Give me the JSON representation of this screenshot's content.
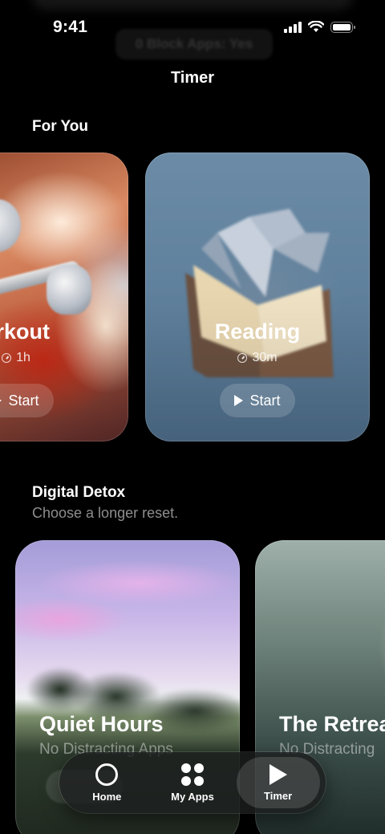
{
  "status_bar": {
    "time": "9:41"
  },
  "ghost_chip": {
    "label": "0 Block Apps: Yes"
  },
  "header": {
    "title": "Timer"
  },
  "for_you": {
    "title": "For You",
    "cards": [
      {
        "name": "Workout",
        "visible_name": "orkout",
        "duration": "1h",
        "start_label": "Start"
      },
      {
        "name": "Reading",
        "duration": "30m",
        "start_label": "Start"
      }
    ]
  },
  "digital_detox": {
    "title": "Digital Detox",
    "subtitle": "Choose a longer reset.",
    "cards": [
      {
        "name": "Quiet Hours",
        "subtitle": "No Distracting Apps"
      },
      {
        "name": "The Retreat",
        "visible_name": "The Retrea",
        "subtitle": "No Distracting"
      }
    ]
  },
  "tab_bar": {
    "items": [
      {
        "label": "Home",
        "icon": "home-icon"
      },
      {
        "label": "My Apps",
        "icon": "apps-grid-icon"
      },
      {
        "label": "Timer",
        "icon": "play-icon",
        "active": true
      }
    ]
  },
  "colors": {
    "background": "#000000",
    "text": "#ffffff",
    "reading_card": "#6b8ba6",
    "tab_bar": "#1c1e1e"
  }
}
